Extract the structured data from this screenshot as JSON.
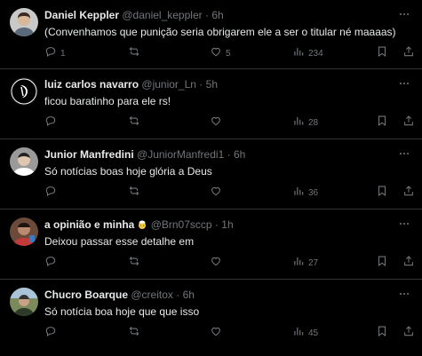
{
  "tweets": [
    {
      "name": "Daniel Keppler",
      "handle": "@daniel_keppler",
      "separator": "·",
      "time": "6h",
      "text": "(Convenhamos que punição seria obrigarem ele a ser o titular né maaaas)",
      "reply_count": "1",
      "retweet_count": "",
      "like_count": "5",
      "view_count": "234",
      "avatar_color": "#c9c9c9"
    },
    {
      "name": "luiz carlos navarro",
      "handle": "@junior_Ln",
      "separator": "·",
      "time": "5h",
      "text": "ficou baratinho para ele rs!",
      "reply_count": "",
      "retweet_count": "",
      "like_count": "",
      "view_count": "28",
      "avatar_color": "#111111"
    },
    {
      "name": "Junior Manfredini",
      "handle": "@JuniorManfredi1",
      "separator": "·",
      "time": "6h",
      "text": "Só notícias boas hoje glória a Deus",
      "reply_count": "",
      "retweet_count": "",
      "like_count": "",
      "view_count": "36",
      "avatar_color": "#9a9a9a"
    },
    {
      "name": "a opinião e minha",
      "handle": "@Brn07sccp",
      "separator": "·",
      "time": "1h",
      "text": "Deixou passar esse detalhe em",
      "reply_count": "",
      "retweet_count": "",
      "like_count": "",
      "view_count": "27",
      "avatar_color": "#6b4a3a"
    },
    {
      "name": "Chucro Boarque",
      "handle": "@creitox",
      "separator": "·",
      "time": "6h",
      "text": "Só notícia boa hoje que que isso",
      "reply_count": "",
      "retweet_count": "",
      "like_count": "",
      "view_count": "45",
      "avatar_color": "#7a8a5a"
    }
  ],
  "icons": {
    "reply": "reply-icon",
    "retweet": "retweet-icon",
    "like": "heart-icon",
    "views": "views-chart-icon",
    "bookmark": "bookmark-icon",
    "share": "share-icon",
    "more": "more-options-icon"
  },
  "colors": {
    "background": "#000000",
    "text": "#e7e9ea",
    "muted": "#71767b",
    "divider": "#2f3336"
  }
}
